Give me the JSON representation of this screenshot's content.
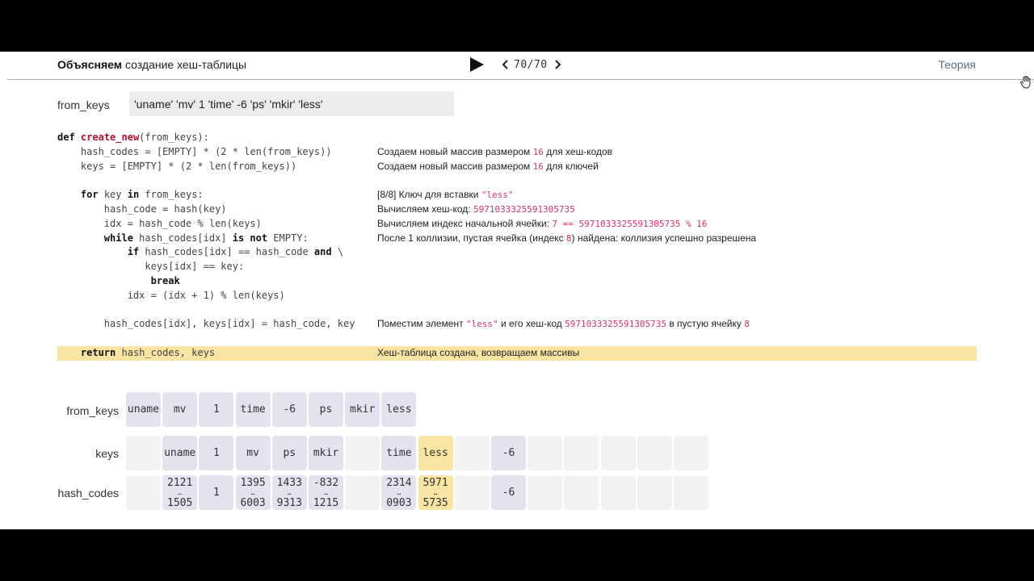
{
  "header": {
    "title_bold": "Объясняем",
    "title_rest": " создание хеш-таблицы",
    "step": "70/70",
    "theory_link": "Теория"
  },
  "input": {
    "label": "from_keys",
    "value": "'uname' 'mv' 1 'time' -6 'ps' 'mkir' 'less'"
  },
  "code": {
    "l1_def": "def",
    "l1_fn": "create_new",
    "l1_rest": "(from_keys):",
    "l2": "    hash_codes = [EMPTY] * (2 * len(from_keys))",
    "l3": "    keys = [EMPTY] * (2 * len(from_keys))",
    "l5_indent": "    ",
    "l5_for": "for",
    "l5_mid": " key ",
    "l5_in": "in",
    "l5_rest": " from_keys:",
    "l6": "        hash_code = hash(key)",
    "l7": "        idx = hash_code % len(keys)",
    "l8_indent": "        ",
    "l8_while": "while",
    "l8_mid": " hash_codes[idx] ",
    "l8_isnot": "is not",
    "l8_rest": " EMPTY:",
    "l9_indent": "            ",
    "l9_if": "if",
    "l9_mid": " hash_codes[idx] == hash_code ",
    "l9_and": "and",
    "l9_rest": " \\",
    "l10": "               keys[idx] == key:",
    "l11_indent": "                ",
    "l11_break": "break",
    "l12": "            idx = (idx + 1) % len(keys)",
    "l14": "        hash_codes[idx], keys[idx] = hash_code, key",
    "l16_indent": "    ",
    "l16_return": "return",
    "l16_rest": " hash_codes, keys"
  },
  "comments": {
    "c2_a": "Создаем новый массив размером ",
    "c2_num": "16",
    "c2_b": " для хеш-кодов",
    "c3_a": "Создаем новый массив размером ",
    "c3_num": "16",
    "c3_b": " для ключей",
    "c5_a": "[8/8] Ключ для вставки ",
    "c5_key": "\"less\"",
    "c6_a": "Вычисляем хеш-код: ",
    "c6_hash": "5971033325591305735",
    "c7_a": "Вычисляем индекс начальной ячейки: ",
    "c7_expr": "7 == 5971033325591305735 % 16",
    "c8_a": "После 1 коллизии, пустая ячейка (индекс ",
    "c8_idx": "8",
    "c8_b": ") найдена: коллизия успешно разрешена",
    "c14_a": "Поместим элемент ",
    "c14_key": "\"less\"",
    "c14_b": " и его хеш-код ",
    "c14_hash": "5971033325591305735",
    "c14_c": " в пустую ячейку ",
    "c14_idx": "8",
    "c16": "Хеш-таблица создана, возвращаем массивы"
  },
  "arrays": {
    "from_keys_label": "from_keys",
    "keys_label": "keys",
    "hash_codes_label": "hash_codes",
    "from_keys": [
      "uname",
      "mv",
      "1",
      "time",
      "-6",
      "ps",
      "mkir",
      "less"
    ],
    "keys": [
      "",
      "uname",
      "1",
      "mv",
      "ps",
      "mkir",
      "",
      "time",
      "less",
      "",
      "-6",
      "",
      "",
      "",
      "",
      ""
    ],
    "hash_codes": [
      {
        "top": "",
        "bottom": ""
      },
      {
        "top": "2121",
        "bottom": "1505"
      },
      {
        "top": "1",
        "bottom": ""
      },
      {
        "top": "1395",
        "bottom": "6003"
      },
      {
        "top": "1433",
        "bottom": "9313"
      },
      {
        "top": "-832",
        "bottom": "1215"
      },
      {
        "top": "",
        "bottom": ""
      },
      {
        "top": "2314",
        "bottom": "0903"
      },
      {
        "top": "5971",
        "bottom": "5735"
      },
      {
        "top": "",
        "bottom": ""
      },
      {
        "top": "-6",
        "bottom": ""
      },
      {
        "top": "",
        "bottom": ""
      },
      {
        "top": "",
        "bottom": ""
      },
      {
        "top": "",
        "bottom": ""
      },
      {
        "top": "",
        "bottom": ""
      },
      {
        "top": "",
        "bottom": ""
      }
    ],
    "highlight_index": 8,
    "dots": "…"
  },
  "colors": {
    "highlight": "#f9e4a4",
    "accent_pink": "#d6336c",
    "filled_cell": "#e3e3ee",
    "empty_cell": "#f2f2f5"
  },
  "icons": [
    "play-icon",
    "chevron-left-icon",
    "chevron-right-icon",
    "hand-cursor-icon"
  ]
}
